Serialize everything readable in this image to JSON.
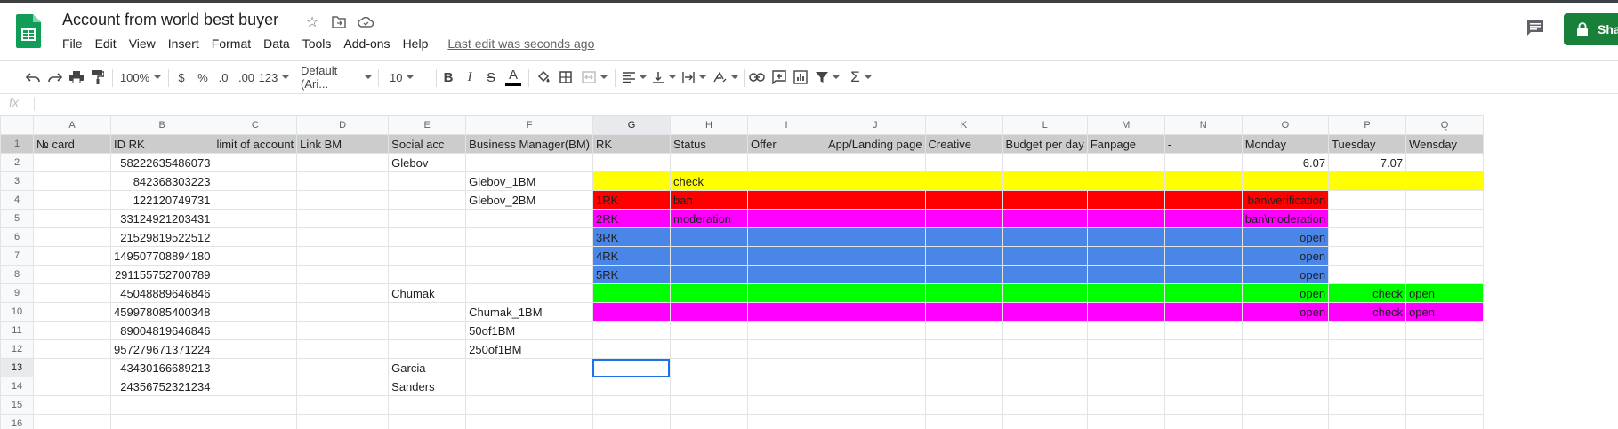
{
  "app": {
    "title": "Account from world best buyer",
    "last_edit": "Last edit was seconds ago",
    "share_label": "Share"
  },
  "menu": [
    "File",
    "Edit",
    "View",
    "Insert",
    "Format",
    "Data",
    "Tools",
    "Add-ons",
    "Help"
  ],
  "toolbar": {
    "zoom": "100%",
    "currency": "$",
    "percent": "%",
    "dec_decrease": ".0",
    "dec_increase": ".00",
    "more_formats": "123",
    "font": "Default (Ari...",
    "font_size": "10",
    "bold": "B",
    "italic": "I",
    "strike": "S",
    "text_color": "A"
  },
  "formula_bar": {
    "fx": "fx",
    "value": ""
  },
  "colors": {
    "yellow": "#ffff00",
    "red": "#ff0000",
    "magenta": "#ff00ff",
    "blue": "#4a86e8",
    "green": "#00ff00",
    "header_gray": "#cccccc",
    "share_green": "#188038",
    "selection": "#1a73e8"
  },
  "grid": {
    "columns": [
      "A",
      "B",
      "C",
      "D",
      "E",
      "F",
      "G",
      "H",
      "I",
      "J",
      "K",
      "L",
      "M",
      "N",
      "O",
      "P",
      "Q"
    ],
    "rows": [
      [
        "№ card",
        "ID RK",
        "limit of account",
        "Link BM",
        "Social acc",
        "Business Manager(BM)",
        "RK",
        "Status",
        "Offer",
        "App/Landing page",
        "Creative",
        "Budget per day",
        "Fanpage",
        "-",
        "Monday",
        "Tuesday",
        "Wensday"
      ],
      [
        "",
        "58222635486073",
        "",
        "",
        "Glebov",
        "",
        "",
        "",
        "",
        "",
        "",
        "",
        "",
        "",
        "6.07",
        "7.07",
        ""
      ],
      [
        "",
        "842368303223",
        "",
        "",
        "",
        "Glebov_1BM",
        "",
        "check",
        "",
        "",
        "",
        "",
        "",
        "",
        "",
        "",
        ""
      ],
      [
        "",
        "122120749731",
        "",
        "",
        "",
        "Glebov_2BM",
        "1RK",
        "ban",
        "",
        "",
        "",
        "",
        "",
        "",
        "ban\\verification",
        "",
        ""
      ],
      [
        "",
        "33124921203431",
        "",
        "",
        "",
        "",
        "2RK",
        "moderation",
        "",
        "",
        "",
        "",
        "",
        "",
        "ban\\moderation",
        "",
        ""
      ],
      [
        "",
        "21529819522512",
        "",
        "",
        "",
        "",
        "3RK",
        "",
        "",
        "",
        "",
        "",
        "",
        "",
        "open",
        "",
        ""
      ],
      [
        "",
        "149507708894180",
        "",
        "",
        "",
        "",
        "4RK",
        "",
        "",
        "",
        "",
        "",
        "",
        "",
        "open",
        "",
        ""
      ],
      [
        "",
        "291155752700789",
        "",
        "",
        "",
        "",
        "5RK",
        "",
        "",
        "",
        "",
        "",
        "",
        "",
        "open",
        "",
        ""
      ],
      [
        "",
        "45048889646846",
        "",
        "",
        "Chumak",
        "",
        "",
        "",
        "",
        "",
        "",
        "",
        "",
        "",
        "open",
        "check",
        "open"
      ],
      [
        "",
        "459978085400348",
        "",
        "",
        "",
        "Chumak_1BM",
        "",
        "",
        "",
        "",
        "",
        "",
        "",
        "",
        "open",
        "check",
        "open"
      ],
      [
        "",
        "89004819646846",
        "",
        "",
        "",
        "50of1BM",
        "",
        "",
        "",
        "",
        "",
        "",
        "",
        "",
        "",
        "",
        ""
      ],
      [
        "",
        "957279671371224",
        "",
        "",
        "",
        "250of1BM",
        "",
        "",
        "",
        "",
        "",
        "",
        "",
        "",
        "",
        "",
        ""
      ],
      [
        "",
        "43430166689213",
        "",
        "",
        "Garcia",
        "",
        "",
        "",
        "",
        "",
        "",
        "",
        "",
        "",
        "",
        "",
        ""
      ],
      [
        "",
        "24356752321234",
        "",
        "",
        "Sanders",
        "",
        "",
        "",
        "",
        "",
        "",
        "",
        "",
        "",
        "",
        "",
        ""
      ],
      [
        "",
        "",
        "",
        "",
        "",
        "",
        "",
        "",
        "",
        "",
        "",
        "",
        "",
        "",
        "",
        "",
        ""
      ],
      [
        "",
        "",
        "",
        "",
        "",
        "",
        "",
        "",
        "",
        "",
        "",
        "",
        "",
        "",
        "",
        "",
        ""
      ]
    ]
  }
}
